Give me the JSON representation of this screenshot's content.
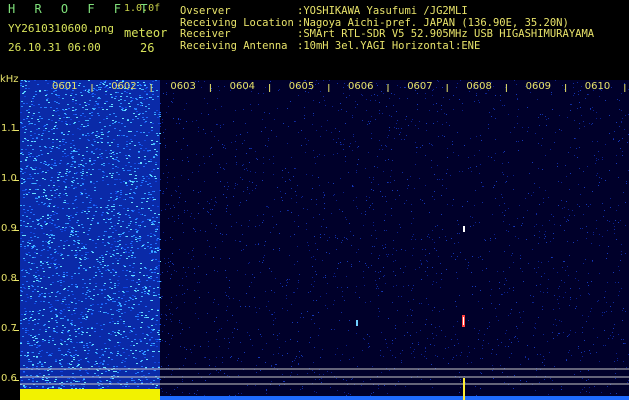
{
  "app": {
    "logo": "H R O F F T",
    "version": "1.0.0f",
    "filename": "YY2610310600.png",
    "datetime": "26.10.31 06:00",
    "meteor_label": "meteor",
    "meteor_count": "26"
  },
  "info": {
    "observer_label": "Ovserver",
    "observer": ":YOSHIKAWA Yasufumi /JG2MLI",
    "location_label": "Receiving Location",
    "location": ":Nagoya Aichi-pref. JAPAN (136.90E, 35.20N)",
    "receiver_label": "Receiver",
    "receiver": ":SMArt RTL-SDR V5 52.905MHz USB HIGASHIMURAYAMA",
    "antenna_label": "Receiving Antenna",
    "antenna": ":10mH 3el.YAGI Horizontal:ENE"
  },
  "axis": {
    "unit": "kHz",
    "freq_labels": [
      "1.1",
      "1.0",
      "0.9",
      "0.8",
      "0.7",
      "0.6"
    ],
    "time_labels": [
      "0601",
      "0602",
      "0603",
      "0604",
      "0605",
      "0606",
      "0607",
      "0608",
      "0609",
      "0610"
    ]
  },
  "colors": {
    "text_yellow": "#E8E36A",
    "logo_green": "#7FE07A",
    "spectrogram_background": "#00002A",
    "noise_bright": "#1E6BFF",
    "baseline_yellow": "#F2F200"
  }
}
